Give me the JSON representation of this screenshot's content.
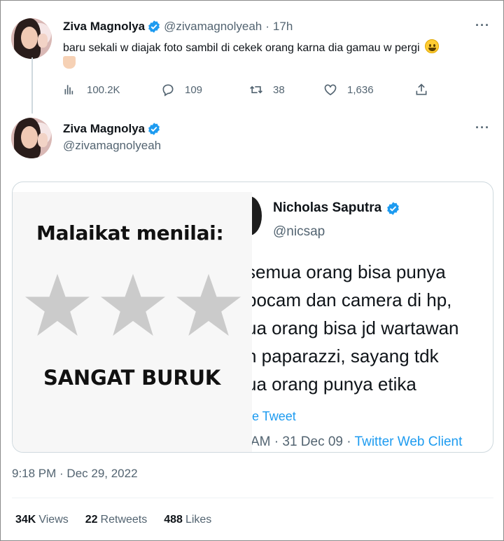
{
  "tweet": {
    "author_name": "Ziva Magnolya",
    "author_handle": "@zivamagnolyeah",
    "separator": "·",
    "age": "17h",
    "more": "···",
    "text": "baru sekali w diajak foto sambil di cekek orang karna dia gamau w pergi",
    "actions": {
      "views": "100.2K",
      "replies": "109",
      "retweets": "38",
      "likes": "1,636"
    }
  },
  "reply_tweet": {
    "author_name": "Ziva Magnolya",
    "author_handle": "@zivamagnolyeah",
    "more": "···",
    "image": {
      "left_heading": "Malaikat menilai:",
      "rating_stars": 3,
      "left_verdict": "SANGAT BURUK",
      "quoted_name": "Nicholas Saputra",
      "quoted_handle": "@nicsap",
      "quoted_lines": [
        "semua orang bisa punya",
        "pocam dan camera di hp,",
        "ua orang bisa jd wartawan",
        "n paparazzi, sayang tdk",
        "ua orang punya etika"
      ],
      "see_tweet": "e Tweet",
      "meta_time": "AM · 31 Dec 09 · ",
      "meta_client": "Twitter Web Client"
    },
    "timestamp": "9:18 PM · Dec 29, 2022",
    "stats": {
      "views_count": "34K",
      "views_label": "Views",
      "retweets_count": "22",
      "retweets_label": "Retweets",
      "likes_count": "488",
      "likes_label": "Likes"
    }
  },
  "colors": {
    "verified": "#1d9bf0",
    "secondary_text": "#536471",
    "link": "#1d9bf0",
    "star": "#cbcbcb"
  }
}
